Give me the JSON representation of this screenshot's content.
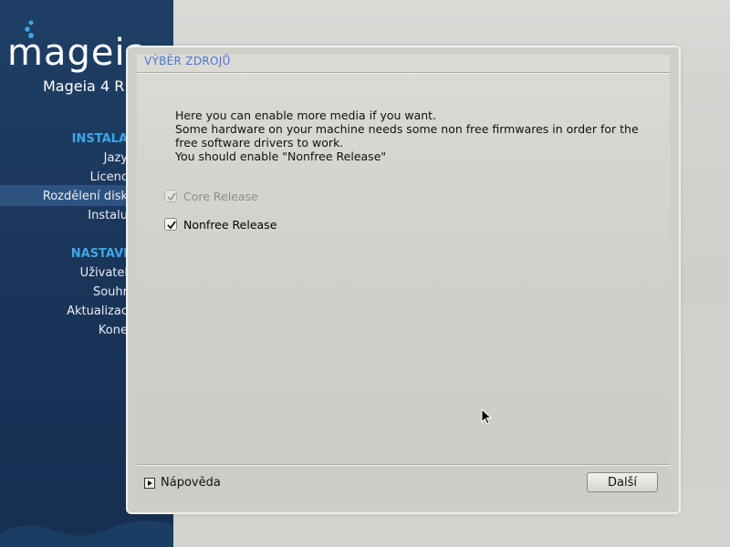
{
  "sidebar": {
    "logo_text": "mageia",
    "product_title": "Mageia 4 R",
    "sections": [
      {
        "title": "INSTALA",
        "steps": [
          "Jazy",
          "Licenc",
          "Rozdělení disk",
          "Instalu"
        ]
      },
      {
        "title": "NASTAVI",
        "steps": [
          "Uživatel",
          "Souhr",
          "Aktualizac",
          "Kone"
        ]
      }
    ],
    "active_step": "Rozdělení disk"
  },
  "dialog": {
    "title": "VÝBĚR ZDROJŮ",
    "intro_lines": [
      "Here you can enable more media if you want.",
      "Some hardware on your machine needs some non free firmwares in order for the",
      "free software drivers to work.",
      "You should enable \"Nonfree Release\""
    ],
    "media": [
      {
        "label": "Core Release",
        "checked": true,
        "disabled": true
      },
      {
        "label": "Nonfree Release",
        "checked": true,
        "disabled": false
      }
    ],
    "help_label": "Nápověda",
    "next_label": "Další"
  },
  "colors": {
    "sidebar_bg": "#1a3558",
    "section_title": "#3fa6e6",
    "dialog_title": "#4a78c8"
  }
}
